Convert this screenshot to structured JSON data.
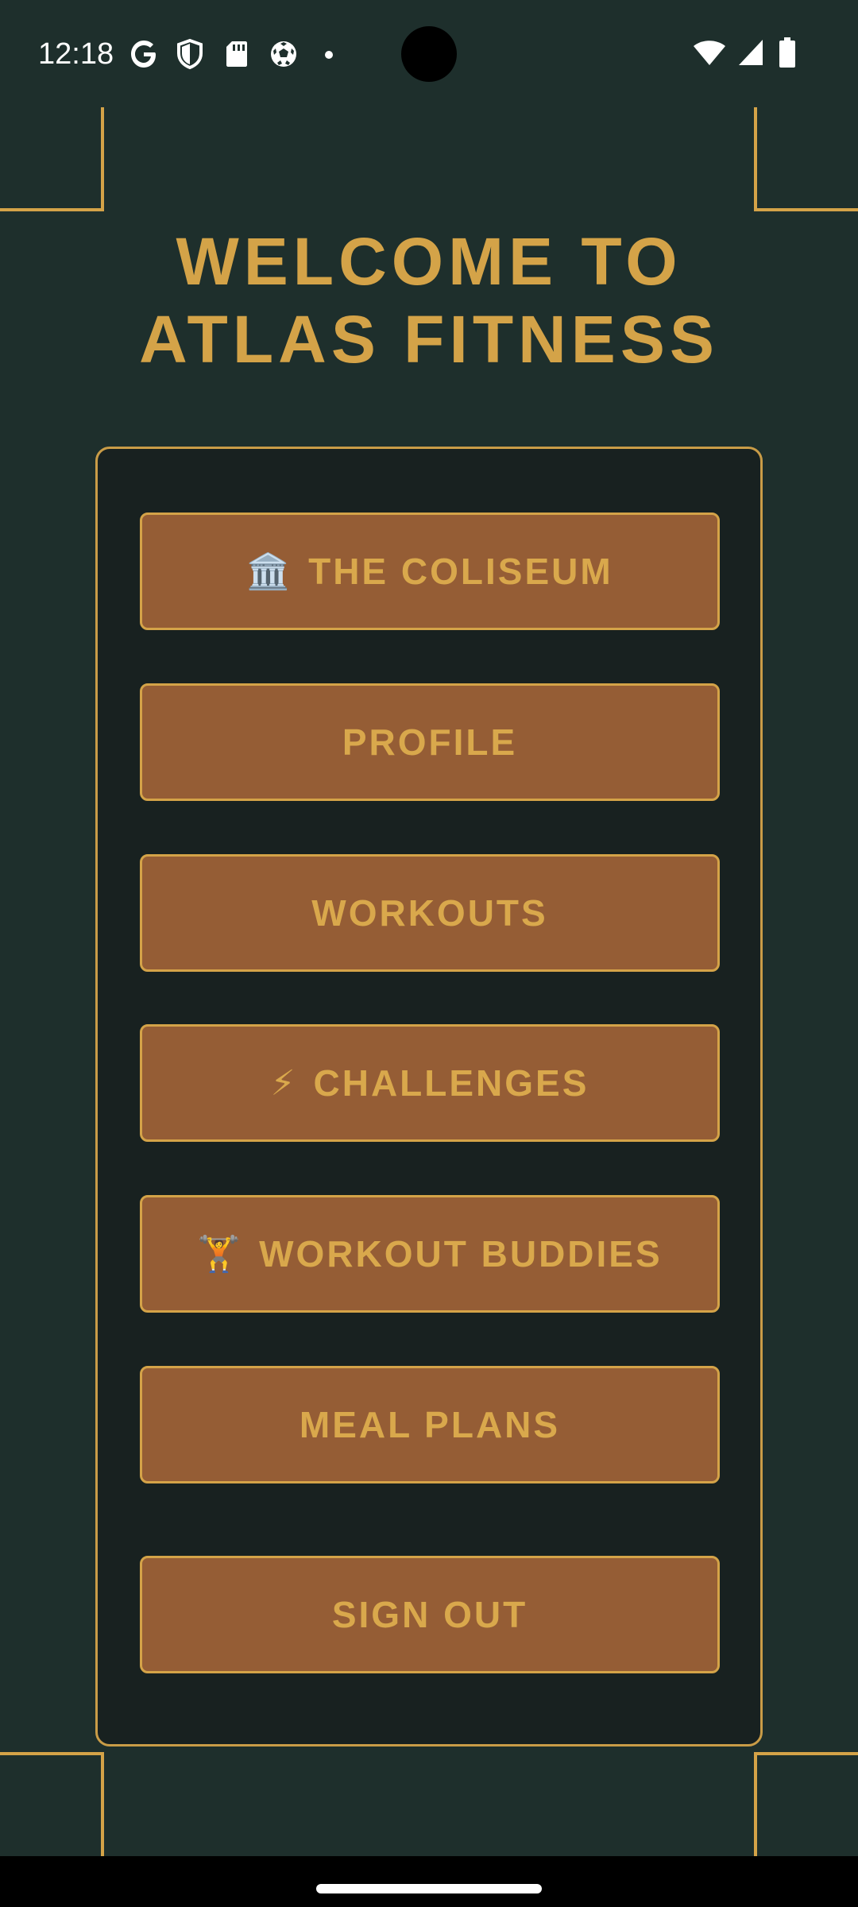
{
  "status_bar": {
    "time": "12:18",
    "left_icons": [
      "google-icon",
      "shield-icon",
      "sd-card-icon",
      "soccer-ball-icon",
      "dot-icon"
    ],
    "right_icons": [
      "wifi-icon",
      "cellular-signal-icon",
      "battery-icon"
    ]
  },
  "welcome": {
    "title": "WELCOME TO ATLAS FITNESS"
  },
  "menu": {
    "coliseum": {
      "icon": "🏛️",
      "label": "THE COLISEUM"
    },
    "profile": {
      "label": "PROFILE"
    },
    "workouts": {
      "label": "WORKOUTS"
    },
    "challenges": {
      "icon": "⚡",
      "label": "CHALLENGES"
    },
    "buddies": {
      "icon": "🏋️",
      "label": "WORKOUT BUDDIES"
    },
    "meal_plans": {
      "label": "MEAL PLANS"
    },
    "sign_out": {
      "label": "SIGN OUT"
    }
  },
  "colors": {
    "background": "#1e2f2c",
    "panel": "#182120",
    "accent_gold": "#d4a348",
    "button_bg": "#955d35"
  }
}
